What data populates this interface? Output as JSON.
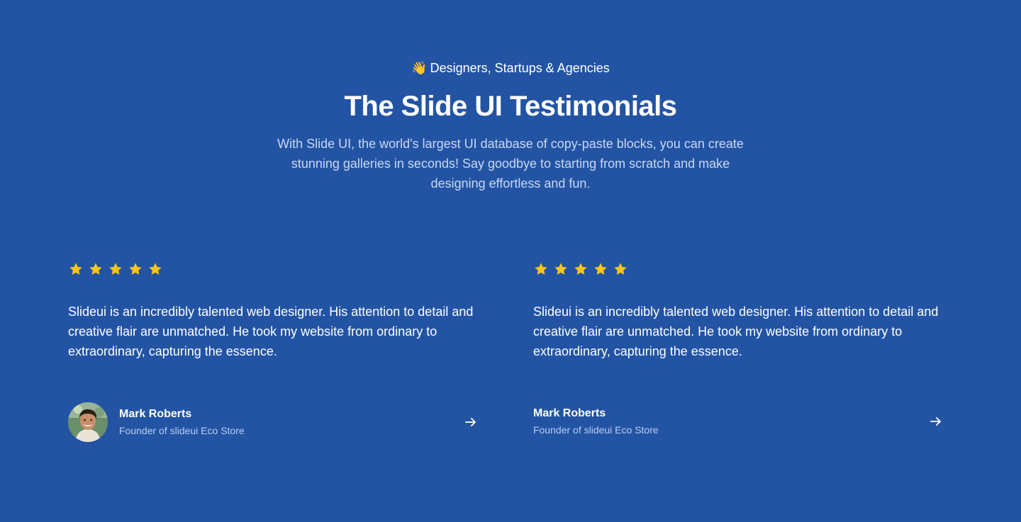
{
  "header": {
    "eyebrow_emoji": "👋",
    "eyebrow_text": "Designers, Startups & Agencies",
    "title": "The Slide UI Testimonials",
    "subtitle": "With Slide UI, the world's largest UI database of copy-paste blocks, you can create stunning galleries in seconds! Say goodbye to starting from scratch and make designing effortless and fun."
  },
  "colors": {
    "background": "#2354a4",
    "star": "#f5c518",
    "subtitle": "#c9d8f2"
  },
  "testimonials": [
    {
      "rating": 5,
      "quote": "Slideui is an incredibly talented web designer. His attention to detail and creative flair are unmatched. He took my website from ordinary to extraordinary, capturing the essence.",
      "name": "Mark Roberts",
      "role": "Founder of slideui Eco Store",
      "has_avatar": true,
      "arrow_icon": "arrow-right-icon"
    },
    {
      "rating": 5,
      "quote": "Slideui is an incredibly talented web designer. His attention to detail and creative flair are unmatched. He took my website from ordinary to extraordinary, capturing the essence.",
      "name": "Mark Roberts",
      "role": "Founder of slideui Eco Store",
      "has_avatar": false,
      "arrow_icon": "arrow-right-icon"
    }
  ]
}
